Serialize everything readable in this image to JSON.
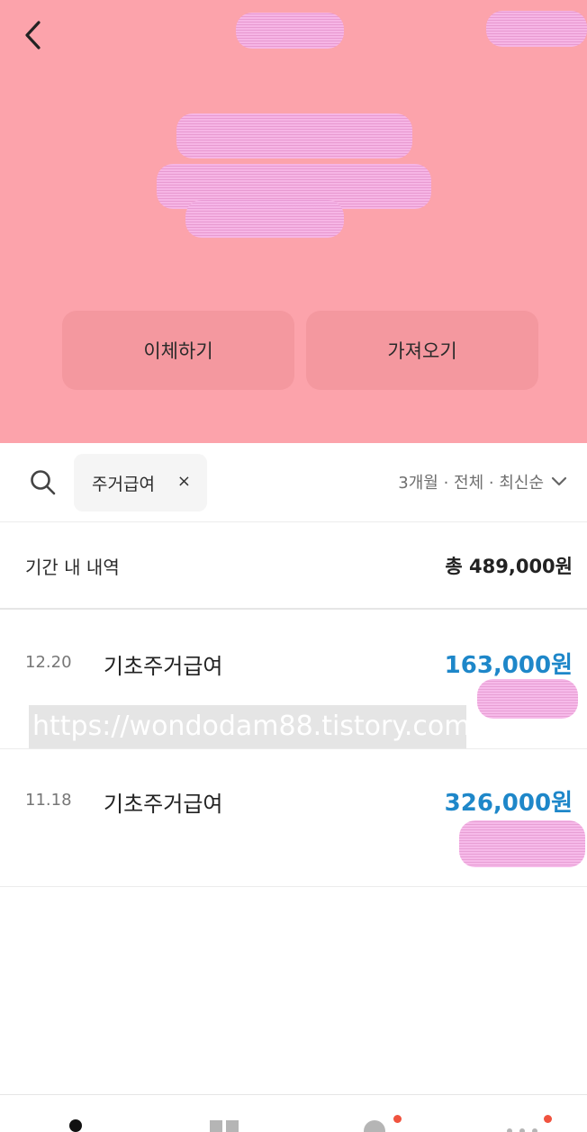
{
  "header": {
    "back_icon": "chevron-left-icon",
    "actions": {
      "transfer_label": "이체하기",
      "bring_label": "가져오기"
    }
  },
  "filter": {
    "search_icon": "search-icon",
    "chip_label": "주거급여",
    "chip_close": "×",
    "sort_label": "3개월 · 전체 · 최신순",
    "sort_icon": "chevron-down-icon"
  },
  "summary": {
    "label": "기간 내 내역",
    "total": "총 489,000원"
  },
  "transactions": [
    {
      "date": "12.20",
      "title": "기초주거급여",
      "amount": "163,000원"
    },
    {
      "date": "11.18",
      "title": "기초주거급여",
      "amount": "326,000원"
    }
  ],
  "watermark": "https://wondodam88.tistory.com",
  "colors": {
    "header_bg": "#fca3ab",
    "button_bg": "#f4989f",
    "amount_blue": "#1e87c9",
    "badge_red": "#f0533f"
  },
  "tabbar": {
    "icons": [
      "home-icon",
      "grid-icon",
      "profile-icon",
      "more-icon"
    ]
  }
}
